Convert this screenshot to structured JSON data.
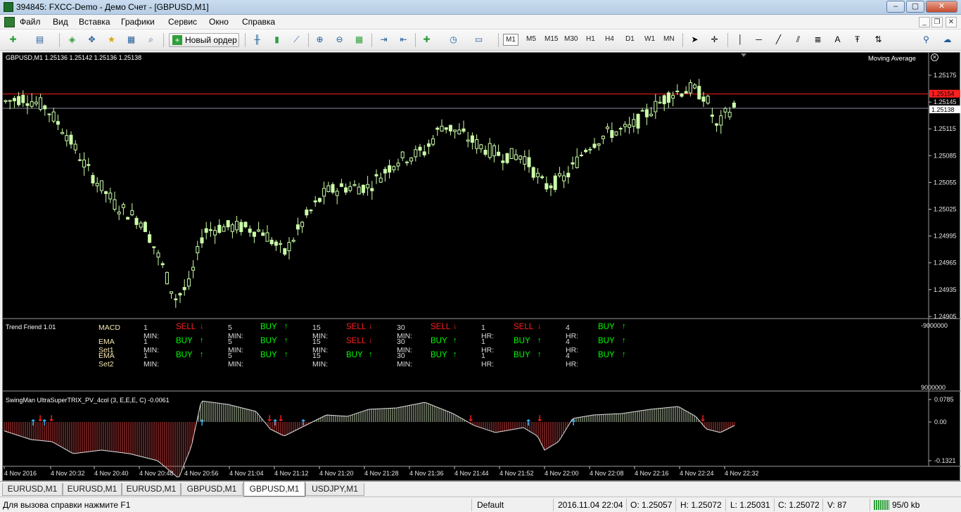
{
  "window": {
    "title": "394845: FXCC-Demo - Демо Счет - [GBPUSD,M1]",
    "minimize_glyph": "–",
    "maximize_glyph": "▢",
    "close_glyph": "✕"
  },
  "menu": {
    "items": [
      "Файл",
      "Вид",
      "Вставка",
      "Графики",
      "Сервис",
      "Окно",
      "Справка"
    ],
    "mdi_minimize": "_",
    "mdi_restore": "❐",
    "mdi_close": "✕"
  },
  "toolbar": {
    "new_order_label": "Новый ордер",
    "timeframes": [
      "M1",
      "M5",
      "M15",
      "M30",
      "H1",
      "H4",
      "D1",
      "W1",
      "MN"
    ],
    "active_timeframe": "M1"
  },
  "chart": {
    "header": "GBPUSD,M1  1.25136 1.25142 1.25136 1.25138",
    "indicator_name": "Moving Average",
    "price_axis": [
      "1.25175",
      "1.25145",
      "1.25115",
      "1.25085",
      "1.25055",
      "1.25025",
      "1.24995",
      "1.24965",
      "1.24935",
      "1.24905"
    ],
    "ask_label": "1.25154",
    "bid_label": "1.25138",
    "time_axis": [
      "4 Nov 2016",
      "4 Nov 20:32",
      "4 Nov 20:40",
      "4 Nov 20:48",
      "4 Nov 20:56",
      "4 Nov 21:04",
      "4 Nov 21:12",
      "4 Nov 21:20",
      "4 Nov 21:28",
      "4 Nov 21:36",
      "4 Nov 21:44",
      "4 Nov 21:52",
      "4 Nov 22:00",
      "4 Nov 22:08",
      "4 Nov 22:16",
      "4 Nov 22:24",
      "4 Nov 22:32"
    ],
    "colors": {
      "candle": "#ccffaa",
      "ask_line": "#ff2020",
      "bid_line": "#8a8a9a",
      "background": "#000000"
    }
  },
  "trend_friend": {
    "title": "Trend Friend 1.01",
    "scale_top": "-9000000",
    "scale_bottom": "9000000",
    "rows": [
      {
        "name": "MACD",
        "signals": [
          {
            "tf": "1 MIN:",
            "sig": "SELL"
          },
          {
            "tf": "5 MIN:",
            "sig": "BUY"
          },
          {
            "tf": "15 MIN:",
            "sig": "SELL"
          },
          {
            "tf": "30 MIN:",
            "sig": "SELL"
          },
          {
            "tf": "1 HR:",
            "sig": "SELL"
          },
          {
            "tf": "4 HR:",
            "sig": "BUY"
          }
        ]
      },
      {
        "name": "EMA Set1",
        "signals": [
          {
            "tf": "1 MIN:",
            "sig": "BUY"
          },
          {
            "tf": "5 MIN:",
            "sig": "BUY"
          },
          {
            "tf": "15 MIN:",
            "sig": "SELL"
          },
          {
            "tf": "30 MIN:",
            "sig": "BUY"
          },
          {
            "tf": "1 HR:",
            "sig": "BUY"
          },
          {
            "tf": "4 HR:",
            "sig": "BUY"
          }
        ]
      },
      {
        "name": "EMA Set2",
        "signals": [
          {
            "tf": "1 MIN:",
            "sig": "BUY"
          },
          {
            "tf": "5 MIN:",
            "sig": "BUY"
          },
          {
            "tf": "15 MIN:",
            "sig": "BUY"
          },
          {
            "tf": "30 MIN:",
            "sig": "BUY"
          },
          {
            "tf": "1 HR:",
            "sig": "BUY"
          },
          {
            "tf": "4 HR:",
            "sig": "BUY"
          }
        ]
      }
    ]
  },
  "trix": {
    "title": "SwingMan UltraSuperTRIX_PV_4col (3, E,E,E, C) -0.0061",
    "axis": [
      "0.0785",
      "0.00",
      "-0.1321"
    ]
  },
  "tabs": [
    "EURUSD,M1",
    "EURUSD,M1",
    "EURUSD,M1",
    "GBPUSD,M1",
    "GBPUSD,M1",
    "USDJPY,M1"
  ],
  "active_tab": 4,
  "status": {
    "help": "Для вызова справки нажмите F1",
    "profile": "Default",
    "datetime": "2016.11.04 22:04",
    "open": "O: 1.25057",
    "high": "H: 1.25072",
    "low": "L: 1.25031",
    "close": "C: 1.25072",
    "volume": "V: 87",
    "traffic": "95/0 kb"
  }
}
